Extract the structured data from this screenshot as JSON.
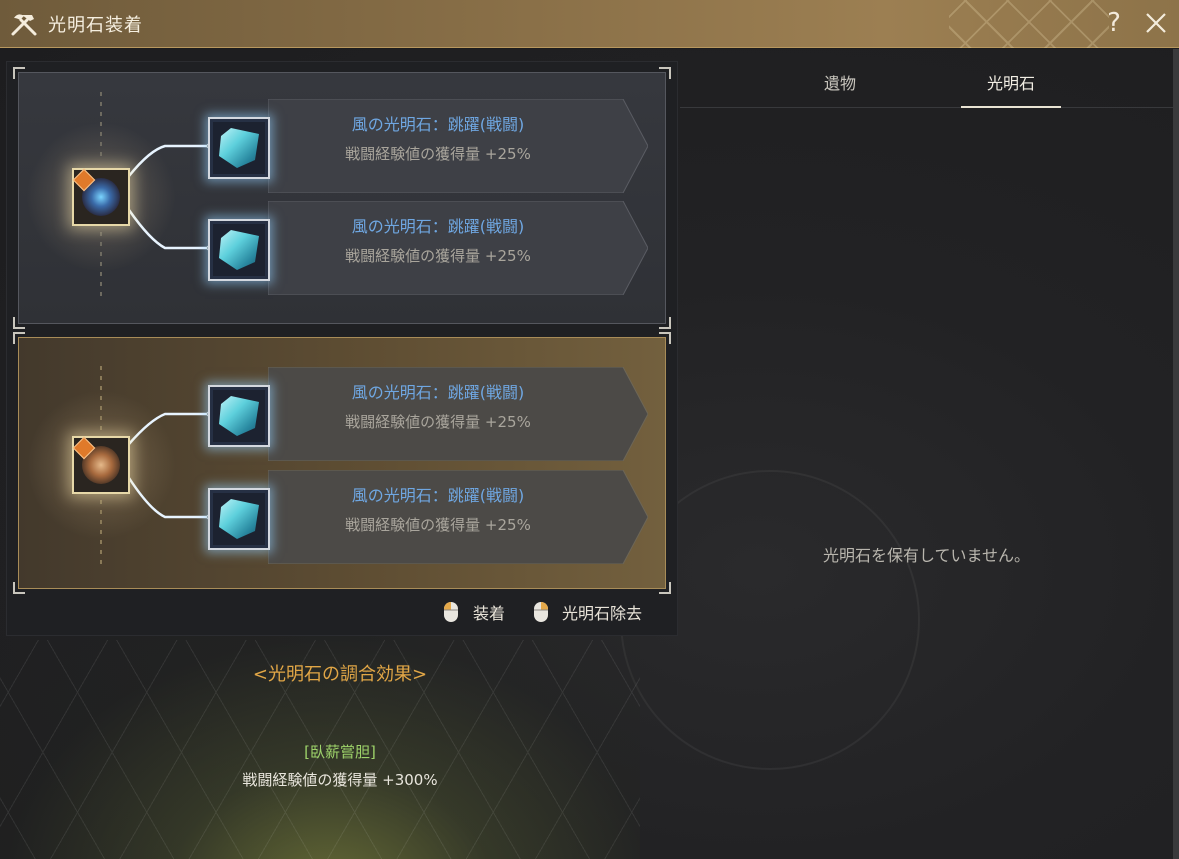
{
  "window": {
    "title": "光明石装着",
    "icon": "hammer-pick-icon",
    "help_label": "?",
    "close_icon": "close-icon"
  },
  "groups": [
    {
      "core_icon": "relic-core-icon",
      "slots": [
        {
          "name": "風の光明石：跳躍(戦闘)",
          "effect": "戦闘経験値の獲得量 +25%",
          "icon": "wind-gem-icon"
        },
        {
          "name": "風の光明石：跳躍(戦闘)",
          "effect": "戦闘経験値の獲得量 +25%",
          "icon": "wind-gem-icon"
        }
      ]
    },
    {
      "core_icon": "relic-core-icon",
      "slots": [
        {
          "name": "風の光明石：跳躍(戦闘)",
          "effect": "戦闘経験値の獲得量 +25%",
          "icon": "wind-gem-icon"
        },
        {
          "name": "風の光明石：跳躍(戦闘)",
          "effect": "戦闘経験値の獲得量 +25%",
          "icon": "wind-gem-icon"
        }
      ]
    }
  ],
  "legend": {
    "equip_label": "装着",
    "remove_label": "光明石除去"
  },
  "synergy": {
    "title": "<光明石の調合効果>",
    "name": "[臥薪嘗胆]",
    "effect": "戦闘経験値の獲得量 +300%"
  },
  "tabs": [
    {
      "label": "遺物",
      "active": false
    },
    {
      "label": "光明石",
      "active": true
    }
  ],
  "empty_message": "光明石を保有していません。",
  "colors": {
    "title_bar": "#8a7048",
    "slot_name": "#6fa7e2",
    "synergy_title": "#e1a646",
    "synergy_name": "#9ed36a"
  }
}
